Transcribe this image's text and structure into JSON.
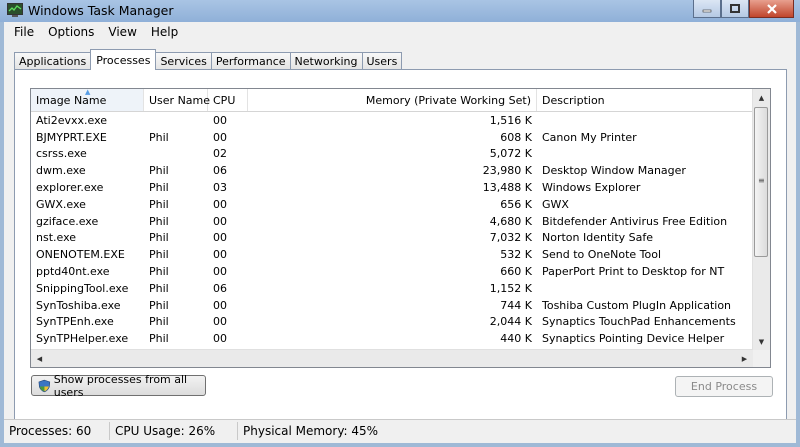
{
  "window": {
    "title": "Windows Task Manager"
  },
  "menu": [
    "File",
    "Options",
    "View",
    "Help"
  ],
  "tabs": [
    "Applications",
    "Processes",
    "Services",
    "Performance",
    "Networking",
    "Users"
  ],
  "active_tab": "Processes",
  "columns": [
    "Image Name",
    "User Name",
    "CPU",
    "Memory (Private Working Set)",
    "Description"
  ],
  "sorted_column": "Image Name",
  "processes": [
    [
      "Ati2evxx.exe",
      "",
      "00",
      "1,516 K",
      ""
    ],
    [
      "BJMYPRT.EXE",
      "Phil",
      "00",
      "608 K",
      "Canon My Printer"
    ],
    [
      "csrss.exe",
      "",
      "02",
      "5,072 K",
      ""
    ],
    [
      "dwm.exe",
      "Phil",
      "06",
      "23,980 K",
      "Desktop Window Manager"
    ],
    [
      "explorer.exe",
      "Phil",
      "03",
      "13,488 K",
      "Windows Explorer"
    ],
    [
      "GWX.exe",
      "Phil",
      "00",
      "656 K",
      "GWX"
    ],
    [
      "gziface.exe",
      "Phil",
      "00",
      "4,680 K",
      "Bitdefender Antivirus Free Edition"
    ],
    [
      "nst.exe",
      "Phil",
      "00",
      "7,032 K",
      "Norton Identity Safe"
    ],
    [
      "ONENOTEM.EXE",
      "Phil",
      "00",
      "532 K",
      "Send to OneNote Tool"
    ],
    [
      "pptd40nt.exe",
      "Phil",
      "00",
      "660 K",
      "PaperPort Print to Desktop for NT"
    ],
    [
      "SnippingTool.exe",
      "Phil",
      "06",
      "1,152 K",
      ""
    ],
    [
      "SynToshiba.exe",
      "Phil",
      "00",
      "744 K",
      "Toshiba Custom PlugIn Application"
    ],
    [
      "SynTPEnh.exe",
      "Phil",
      "00",
      "2,044 K",
      "Synaptics TouchPad Enhancements"
    ],
    [
      "SynTPHelper.exe",
      "Phil",
      "00",
      "440 K",
      "Synaptics Pointing Device Helper"
    ]
  ],
  "buttons": {
    "show_all": "Show processes from all users",
    "end_process": "End Process"
  },
  "status": {
    "processes": "Processes: 60",
    "cpu": "CPU Usage: 26%",
    "memory": "Physical Memory: 45%"
  }
}
